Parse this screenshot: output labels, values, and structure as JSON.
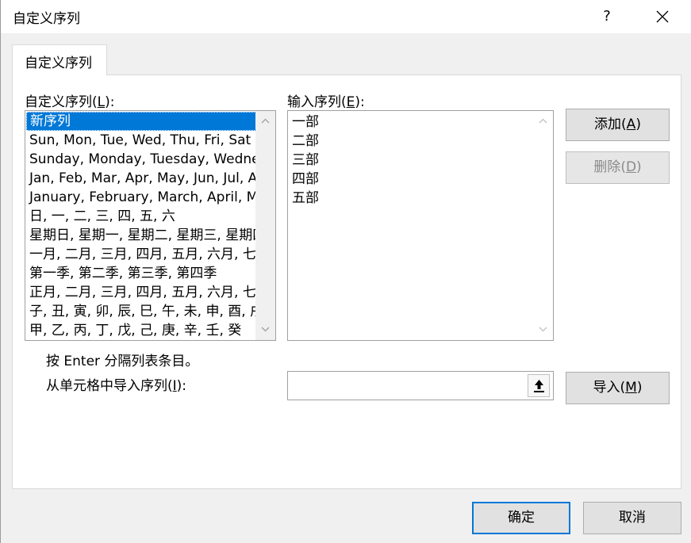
{
  "window": {
    "title": "自定义序列",
    "help_label": "?"
  },
  "tab": {
    "label": "自定义序列"
  },
  "custom_lists": {
    "label": "自定义序列",
    "accel": "L",
    "items": [
      "新序列",
      "Sun, Mon, Tue, Wed, Thu, Fri, Sat",
      "Sunday, Monday, Tuesday, Wednesday, Thursday, Friday, Saturday",
      "Jan, Feb, Mar, Apr, May, Jun, Jul, Aug, Sep, Oct, Nov, Dec",
      "January, February, March, April, May, June, July, August, September, October, November, December",
      "日, 一, 二, 三, 四, 五, 六",
      "星期日, 星期一, 星期二, 星期三, 星期四, 星期五, 星期六",
      "一月, 二月, 三月, 四月, 五月, 六月, 七月, 八月, 九月, 十月, 十一月, 十二月",
      "第一季, 第二季, 第三季, 第四季",
      "正月, 二月, 三月, 四月, 五月, 六月, 七月, 八月, 九月, 十月, 十一月, 腊月",
      "子, 丑, 寅, 卯, 辰, 巳, 午, 未, 申, 酉, 戌, 亥",
      "甲, 乙, 丙, 丁, 戊, 己, 庚, 辛, 壬, 癸"
    ],
    "selected_index": 0
  },
  "list_entries": {
    "label": "输入序列",
    "accel": "E",
    "lines": [
      "一部",
      "二部",
      "三部",
      "四部",
      "五部"
    ]
  },
  "buttons": {
    "add": {
      "label": "添加",
      "accel": "A"
    },
    "delete": {
      "label": "删除",
      "accel": "D"
    },
    "import": {
      "label": "导入",
      "accel": "M"
    },
    "ok": "确定",
    "cancel": "取消"
  },
  "hint": "按 Enter 分隔列表条目。",
  "import_from_cells": {
    "label": "从单元格中导入序列",
    "accel": "I",
    "value": ""
  },
  "colors": {
    "selection": "#0078d7",
    "default_button_border": "#0078d7"
  }
}
